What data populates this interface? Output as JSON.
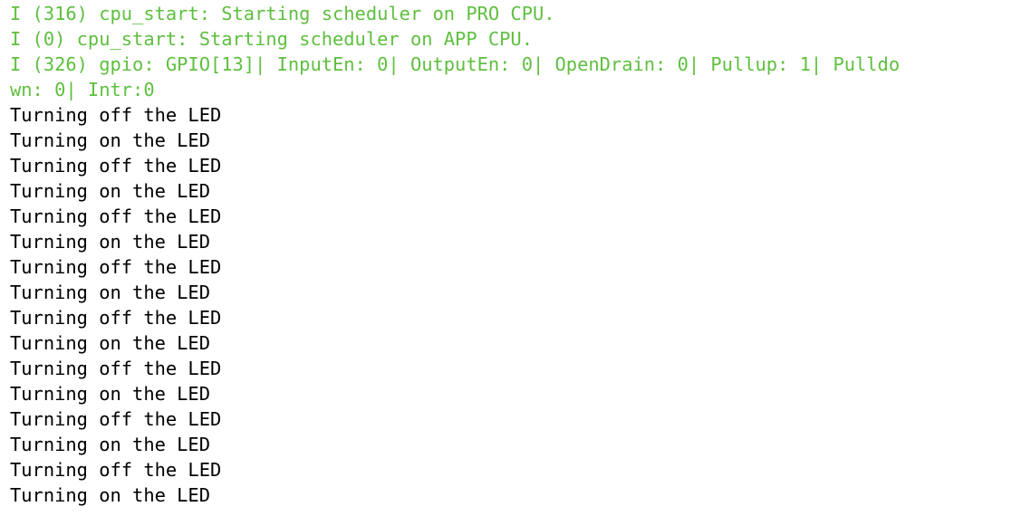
{
  "colors": {
    "info": "#5fbf3f",
    "plain": "#000000",
    "background": "#ffffff"
  },
  "terminal": {
    "lines": [
      "I (316) cpu_start: Starting scheduler on PRO CPU.",
      "I (0) cpu_start: Starting scheduler on APP CPU.",
      "I (326) gpio: GPIO[13]| InputEn: 0| OutputEn: 0| OpenDrain: 0| Pullup: 1| Pulldo",
      "wn: 0| Intr:0",
      "Turning off the LED",
      "Turning on the LED",
      "Turning off the LED",
      "Turning on the LED",
      "Turning off the LED",
      "Turning on the LED",
      "Turning off the LED",
      "Turning on the LED",
      "Turning off the LED",
      "Turning on the LED",
      "Turning off the LED",
      "Turning on the LED",
      "Turning off the LED",
      "Turning on the LED",
      "Turning off the LED",
      "Turning on the LED"
    ]
  }
}
